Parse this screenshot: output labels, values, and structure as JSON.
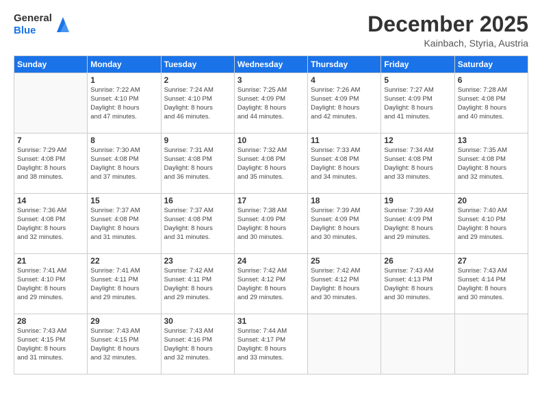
{
  "header": {
    "logo_general": "General",
    "logo_blue": "Blue",
    "month": "December 2025",
    "location": "Kainbach, Styria, Austria"
  },
  "weekdays": [
    "Sunday",
    "Monday",
    "Tuesday",
    "Wednesday",
    "Thursday",
    "Friday",
    "Saturday"
  ],
  "weeks": [
    [
      {
        "day": "",
        "info": ""
      },
      {
        "day": "1",
        "info": "Sunrise: 7:22 AM\nSunset: 4:10 PM\nDaylight: 8 hours\nand 47 minutes."
      },
      {
        "day": "2",
        "info": "Sunrise: 7:24 AM\nSunset: 4:10 PM\nDaylight: 8 hours\nand 46 minutes."
      },
      {
        "day": "3",
        "info": "Sunrise: 7:25 AM\nSunset: 4:09 PM\nDaylight: 8 hours\nand 44 minutes."
      },
      {
        "day": "4",
        "info": "Sunrise: 7:26 AM\nSunset: 4:09 PM\nDaylight: 8 hours\nand 42 minutes."
      },
      {
        "day": "5",
        "info": "Sunrise: 7:27 AM\nSunset: 4:09 PM\nDaylight: 8 hours\nand 41 minutes."
      },
      {
        "day": "6",
        "info": "Sunrise: 7:28 AM\nSunset: 4:08 PM\nDaylight: 8 hours\nand 40 minutes."
      }
    ],
    [
      {
        "day": "7",
        "info": "Sunrise: 7:29 AM\nSunset: 4:08 PM\nDaylight: 8 hours\nand 38 minutes."
      },
      {
        "day": "8",
        "info": "Sunrise: 7:30 AM\nSunset: 4:08 PM\nDaylight: 8 hours\nand 37 minutes."
      },
      {
        "day": "9",
        "info": "Sunrise: 7:31 AM\nSunset: 4:08 PM\nDaylight: 8 hours\nand 36 minutes."
      },
      {
        "day": "10",
        "info": "Sunrise: 7:32 AM\nSunset: 4:08 PM\nDaylight: 8 hours\nand 35 minutes."
      },
      {
        "day": "11",
        "info": "Sunrise: 7:33 AM\nSunset: 4:08 PM\nDaylight: 8 hours\nand 34 minutes."
      },
      {
        "day": "12",
        "info": "Sunrise: 7:34 AM\nSunset: 4:08 PM\nDaylight: 8 hours\nand 33 minutes."
      },
      {
        "day": "13",
        "info": "Sunrise: 7:35 AM\nSunset: 4:08 PM\nDaylight: 8 hours\nand 32 minutes."
      }
    ],
    [
      {
        "day": "14",
        "info": "Sunrise: 7:36 AM\nSunset: 4:08 PM\nDaylight: 8 hours\nand 32 minutes."
      },
      {
        "day": "15",
        "info": "Sunrise: 7:37 AM\nSunset: 4:08 PM\nDaylight: 8 hours\nand 31 minutes."
      },
      {
        "day": "16",
        "info": "Sunrise: 7:37 AM\nSunset: 4:08 PM\nDaylight: 8 hours\nand 31 minutes."
      },
      {
        "day": "17",
        "info": "Sunrise: 7:38 AM\nSunset: 4:09 PM\nDaylight: 8 hours\nand 30 minutes."
      },
      {
        "day": "18",
        "info": "Sunrise: 7:39 AM\nSunset: 4:09 PM\nDaylight: 8 hours\nand 30 minutes."
      },
      {
        "day": "19",
        "info": "Sunrise: 7:39 AM\nSunset: 4:09 PM\nDaylight: 8 hours\nand 29 minutes."
      },
      {
        "day": "20",
        "info": "Sunrise: 7:40 AM\nSunset: 4:10 PM\nDaylight: 8 hours\nand 29 minutes."
      }
    ],
    [
      {
        "day": "21",
        "info": "Sunrise: 7:41 AM\nSunset: 4:10 PM\nDaylight: 8 hours\nand 29 minutes."
      },
      {
        "day": "22",
        "info": "Sunrise: 7:41 AM\nSunset: 4:11 PM\nDaylight: 8 hours\nand 29 minutes."
      },
      {
        "day": "23",
        "info": "Sunrise: 7:42 AM\nSunset: 4:11 PM\nDaylight: 8 hours\nand 29 minutes."
      },
      {
        "day": "24",
        "info": "Sunrise: 7:42 AM\nSunset: 4:12 PM\nDaylight: 8 hours\nand 29 minutes."
      },
      {
        "day": "25",
        "info": "Sunrise: 7:42 AM\nSunset: 4:12 PM\nDaylight: 8 hours\nand 30 minutes."
      },
      {
        "day": "26",
        "info": "Sunrise: 7:43 AM\nSunset: 4:13 PM\nDaylight: 8 hours\nand 30 minutes."
      },
      {
        "day": "27",
        "info": "Sunrise: 7:43 AM\nSunset: 4:14 PM\nDaylight: 8 hours\nand 30 minutes."
      }
    ],
    [
      {
        "day": "28",
        "info": "Sunrise: 7:43 AM\nSunset: 4:15 PM\nDaylight: 8 hours\nand 31 minutes."
      },
      {
        "day": "29",
        "info": "Sunrise: 7:43 AM\nSunset: 4:15 PM\nDaylight: 8 hours\nand 32 minutes."
      },
      {
        "day": "30",
        "info": "Sunrise: 7:43 AM\nSunset: 4:16 PM\nDaylight: 8 hours\nand 32 minutes."
      },
      {
        "day": "31",
        "info": "Sunrise: 7:44 AM\nSunset: 4:17 PM\nDaylight: 8 hours\nand 33 minutes."
      },
      {
        "day": "",
        "info": ""
      },
      {
        "day": "",
        "info": ""
      },
      {
        "day": "",
        "info": ""
      }
    ]
  ]
}
